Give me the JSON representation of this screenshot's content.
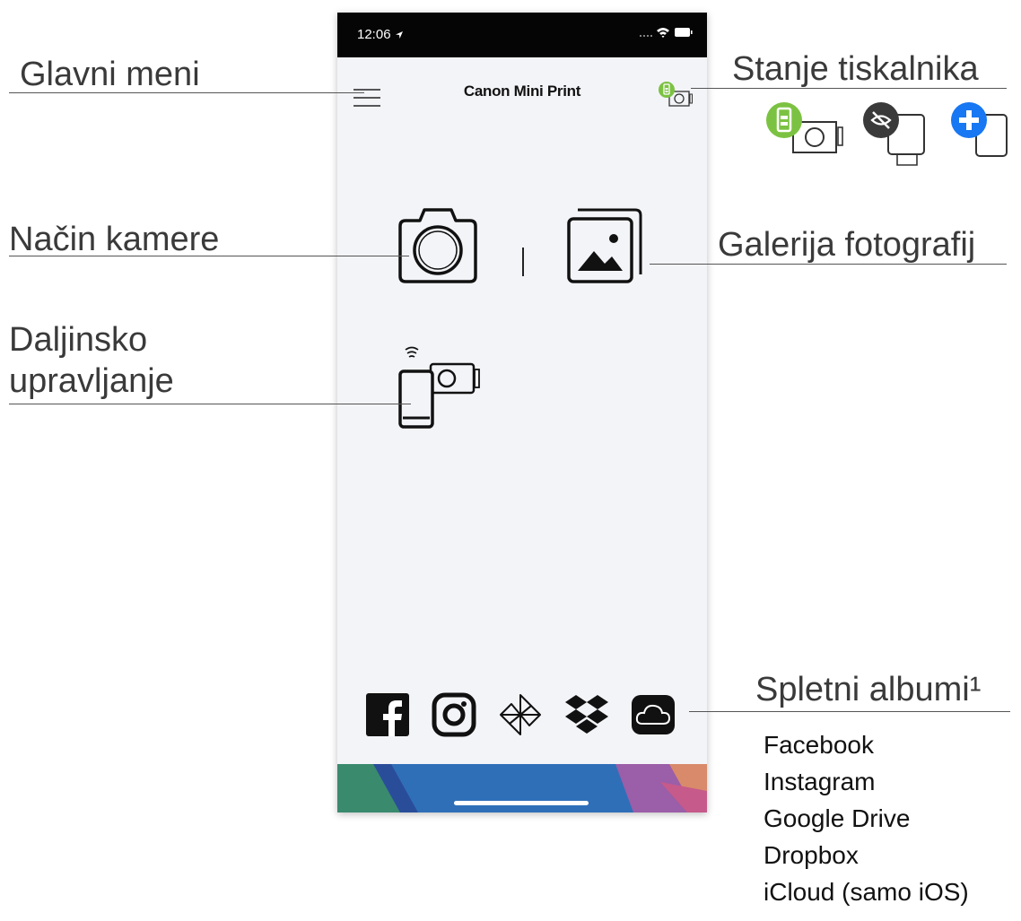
{
  "status_bar": {
    "time": "12:06"
  },
  "app": {
    "title": "Canon Mini Print"
  },
  "callouts": {
    "main_menu": "Glavni meni",
    "printer_status": "Stanje tiskalnika",
    "camera_mode": "Način kamere",
    "photo_gallery": "Galerija fotografij",
    "remote_line1": "Daljinsko",
    "remote_line2": "upravljanje",
    "online_albums": "Spletni albumi¹"
  },
  "online_albums_list": [
    "Facebook",
    "Instagram",
    "Google Drive",
    "Dropbox",
    "iCloud (samo iOS)"
  ],
  "printer_status_icons": [
    "battery-connected-icon",
    "disconnected-icon",
    "add-printer-icon"
  ],
  "colors": {
    "battery_green": "#7cc242",
    "add_blue": "#1877f2",
    "disconnected_gray": "#3a3a3a",
    "footer_blue": "#2f6fb8"
  }
}
